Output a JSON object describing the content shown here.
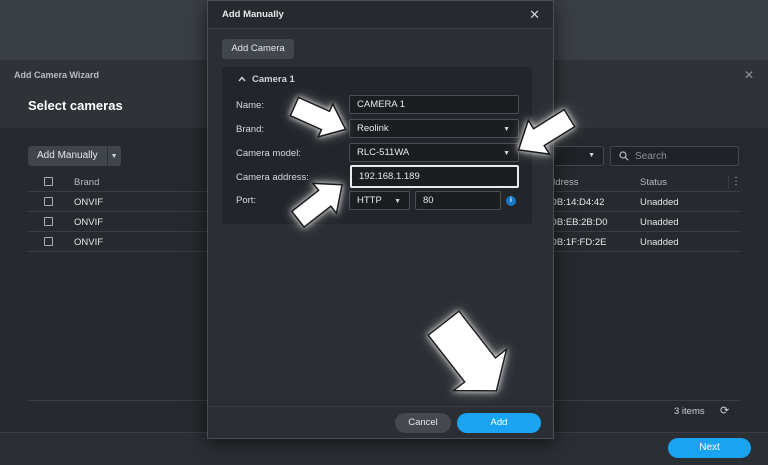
{
  "wizard": {
    "title": "Add Camera Wizard",
    "heading": "Select cameras",
    "close_glyph": "✕",
    "add_manually_label": "Add Manually",
    "search_placeholder": "Search",
    "columns": [
      "Brand",
      "Address",
      "Status"
    ],
    "columns_visible": {
      "brand": "Brand",
      "address_partial": "ddress",
      "status": "Status"
    },
    "rows": [
      {
        "brand": "ONVIF",
        "address_partial": "DB:14:D4:42",
        "status": "Unadded"
      },
      {
        "brand": "ONVIF",
        "address_partial": "DB:EB:2B:D0",
        "status": "Unadded"
      },
      {
        "brand": "ONVIF",
        "address_partial": "DB:1F:FD:2E",
        "status": "Unadded"
      }
    ],
    "items_count": "3 items",
    "next_label": "Next"
  },
  "modal": {
    "title": "Add Manually",
    "close_glyph": "✕",
    "add_camera_label": "Add Camera",
    "section_title": "Camera 1",
    "fields": {
      "name": {
        "label": "Name:",
        "value": "CAMERA 1"
      },
      "brand": {
        "label": "Brand:",
        "value": "Reolink"
      },
      "model": {
        "label": "Camera model:",
        "value": "RLC-511WA"
      },
      "address": {
        "label": "Camera address:",
        "value": "192.168.1.189"
      },
      "port": {
        "label": "Port:",
        "protocol": "HTTP",
        "value": "80"
      }
    },
    "info_glyph": "i",
    "cancel_label": "Cancel",
    "add_label": "Add"
  },
  "icons": {
    "caret": "▼",
    "chevron_up": "^",
    "search": "search-icon",
    "refresh": "⟳",
    "kebab": "⋮"
  },
  "colors": {
    "accent": "#1aa3f0",
    "info": "#1676c2",
    "annotation_arrow": "#ffffff"
  }
}
